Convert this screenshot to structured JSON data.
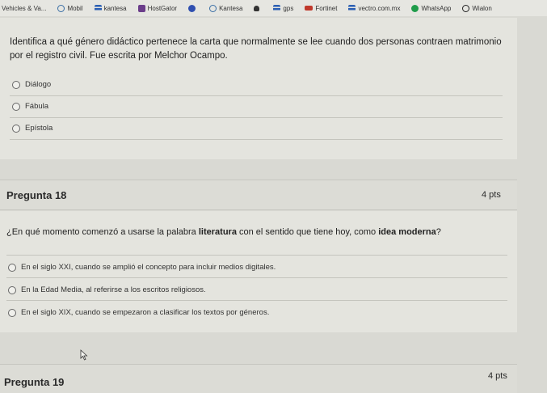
{
  "bookmarks": [
    {
      "label": "Vehicles & Va...",
      "icon": "none"
    },
    {
      "label": "Mobil",
      "icon": "circle"
    },
    {
      "label": "kantesa",
      "icon": "bars"
    },
    {
      "label": "HostGator",
      "icon": "house"
    },
    {
      "label": "",
      "icon": "blue"
    },
    {
      "label": "Kantesa",
      "icon": "circle"
    },
    {
      "label": "",
      "icon": "people"
    },
    {
      "label": "gps",
      "icon": "bars"
    },
    {
      "label": "Fortinet",
      "icon": "red"
    },
    {
      "label": "vectro.com.mx",
      "icon": "bars"
    },
    {
      "label": "WhatsApp",
      "icon": "wa"
    },
    {
      "label": "Wialon",
      "icon": "dark"
    }
  ],
  "q17": {
    "text": "Identifica a qué género didáctico pertenece la carta que normalmente se lee cuando dos personas contraen matrimonio por el registro civil. Fue escrita por Melchor Ocampo.",
    "options": [
      "Diálogo",
      "Fábula",
      "Epístola"
    ]
  },
  "q18": {
    "title": "Pregunta 18",
    "points": "4 pts",
    "text_pre": "¿En qué momento comenzó a usarse la palabra ",
    "text_bold1": "literatura",
    "text_mid": " con el sentido que tiene hoy, como ",
    "text_bold2": "idea moderna",
    "text_post": "?",
    "options": [
      "En el siglo XXI, cuando se amplió el concepto para incluir medios digitales.",
      "En la Edad Media, al referirse a los escritos religiosos.",
      "En el siglo XIX, cuando se empezaron a clasificar los textos por géneros."
    ]
  },
  "q19": {
    "title": "Pregunta 19",
    "points": "4 pts"
  }
}
